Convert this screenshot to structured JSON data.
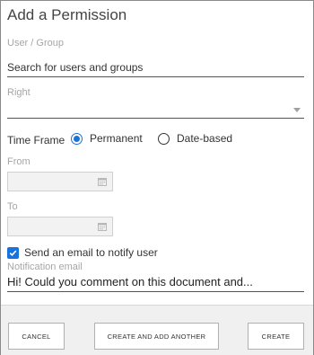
{
  "dialog": {
    "title": "Add a Permission",
    "user_group": {
      "label": "User / Group",
      "placeholder": "Search for users and groups"
    },
    "right": {
      "label": "Right",
      "value": ""
    },
    "time_frame": {
      "label": "Time Frame",
      "options": [
        "Permanent",
        "Date-based"
      ],
      "selected": "Permanent"
    },
    "from": {
      "label": "From",
      "value": ""
    },
    "to": {
      "label": "To",
      "value": ""
    },
    "notify": {
      "checked": true,
      "label": "Send an email to notify user"
    },
    "notification_email": {
      "label": "Notification email",
      "value": "Hi! Could you comment on this document and..."
    }
  },
  "footer": {
    "cancel_label": "CANCEL",
    "create_another_label": "CREATE AND ADD ANOTHER",
    "create_label": "CREATE"
  },
  "colors": {
    "accent": "#1a73d9",
    "footer_bg": "#f0f0f0",
    "date_bg": "#f2f2f2"
  },
  "icons": [
    "chevron-down-icon",
    "calendar-icon",
    "check-icon"
  ]
}
